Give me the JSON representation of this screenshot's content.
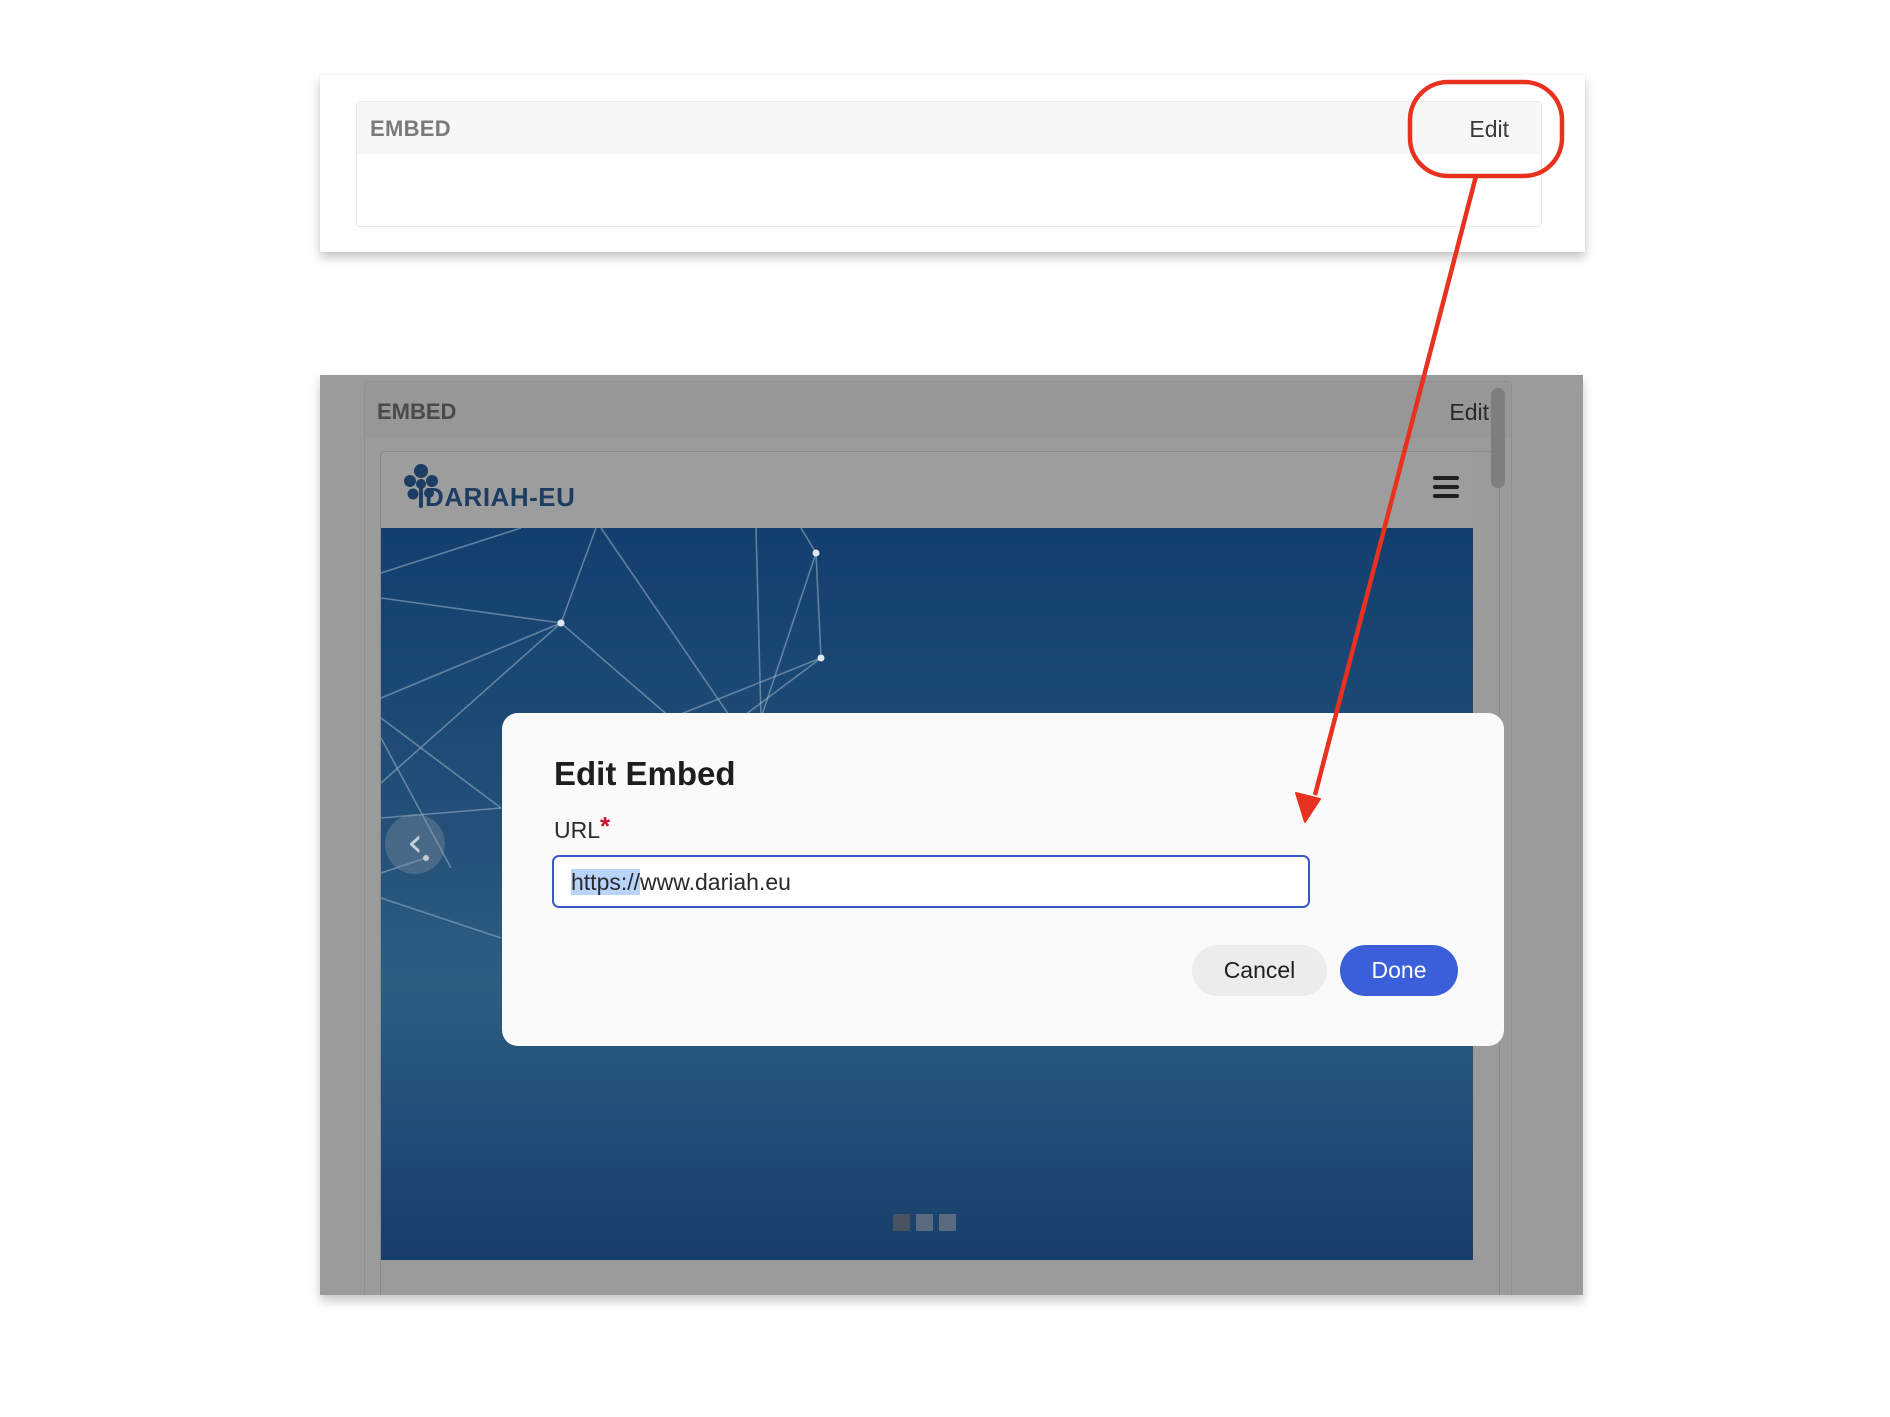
{
  "top_panel": {
    "label": "EMBED",
    "edit_label": "Edit"
  },
  "embed_panel": {
    "label": "EMBED",
    "edit_label": "Edit"
  },
  "embedded_site": {
    "logo_text": "DARIAH-EU",
    "prev_arrow": "‹"
  },
  "modal": {
    "title": "Edit Embed",
    "url_label": "URL",
    "required_mark": "*",
    "url_selected_part": "https://",
    "url_rest": "www.dariah.eu",
    "cancel_label": "Cancel",
    "done_label": "Done"
  },
  "colors": {
    "annotation": "#e8321f",
    "primary": "#3b5fd9",
    "required": "#c8102e"
  },
  "icons": {
    "menu": "hamburger-icon",
    "logo": "dariah-flower-icon",
    "prev": "chevron-left-icon"
  }
}
